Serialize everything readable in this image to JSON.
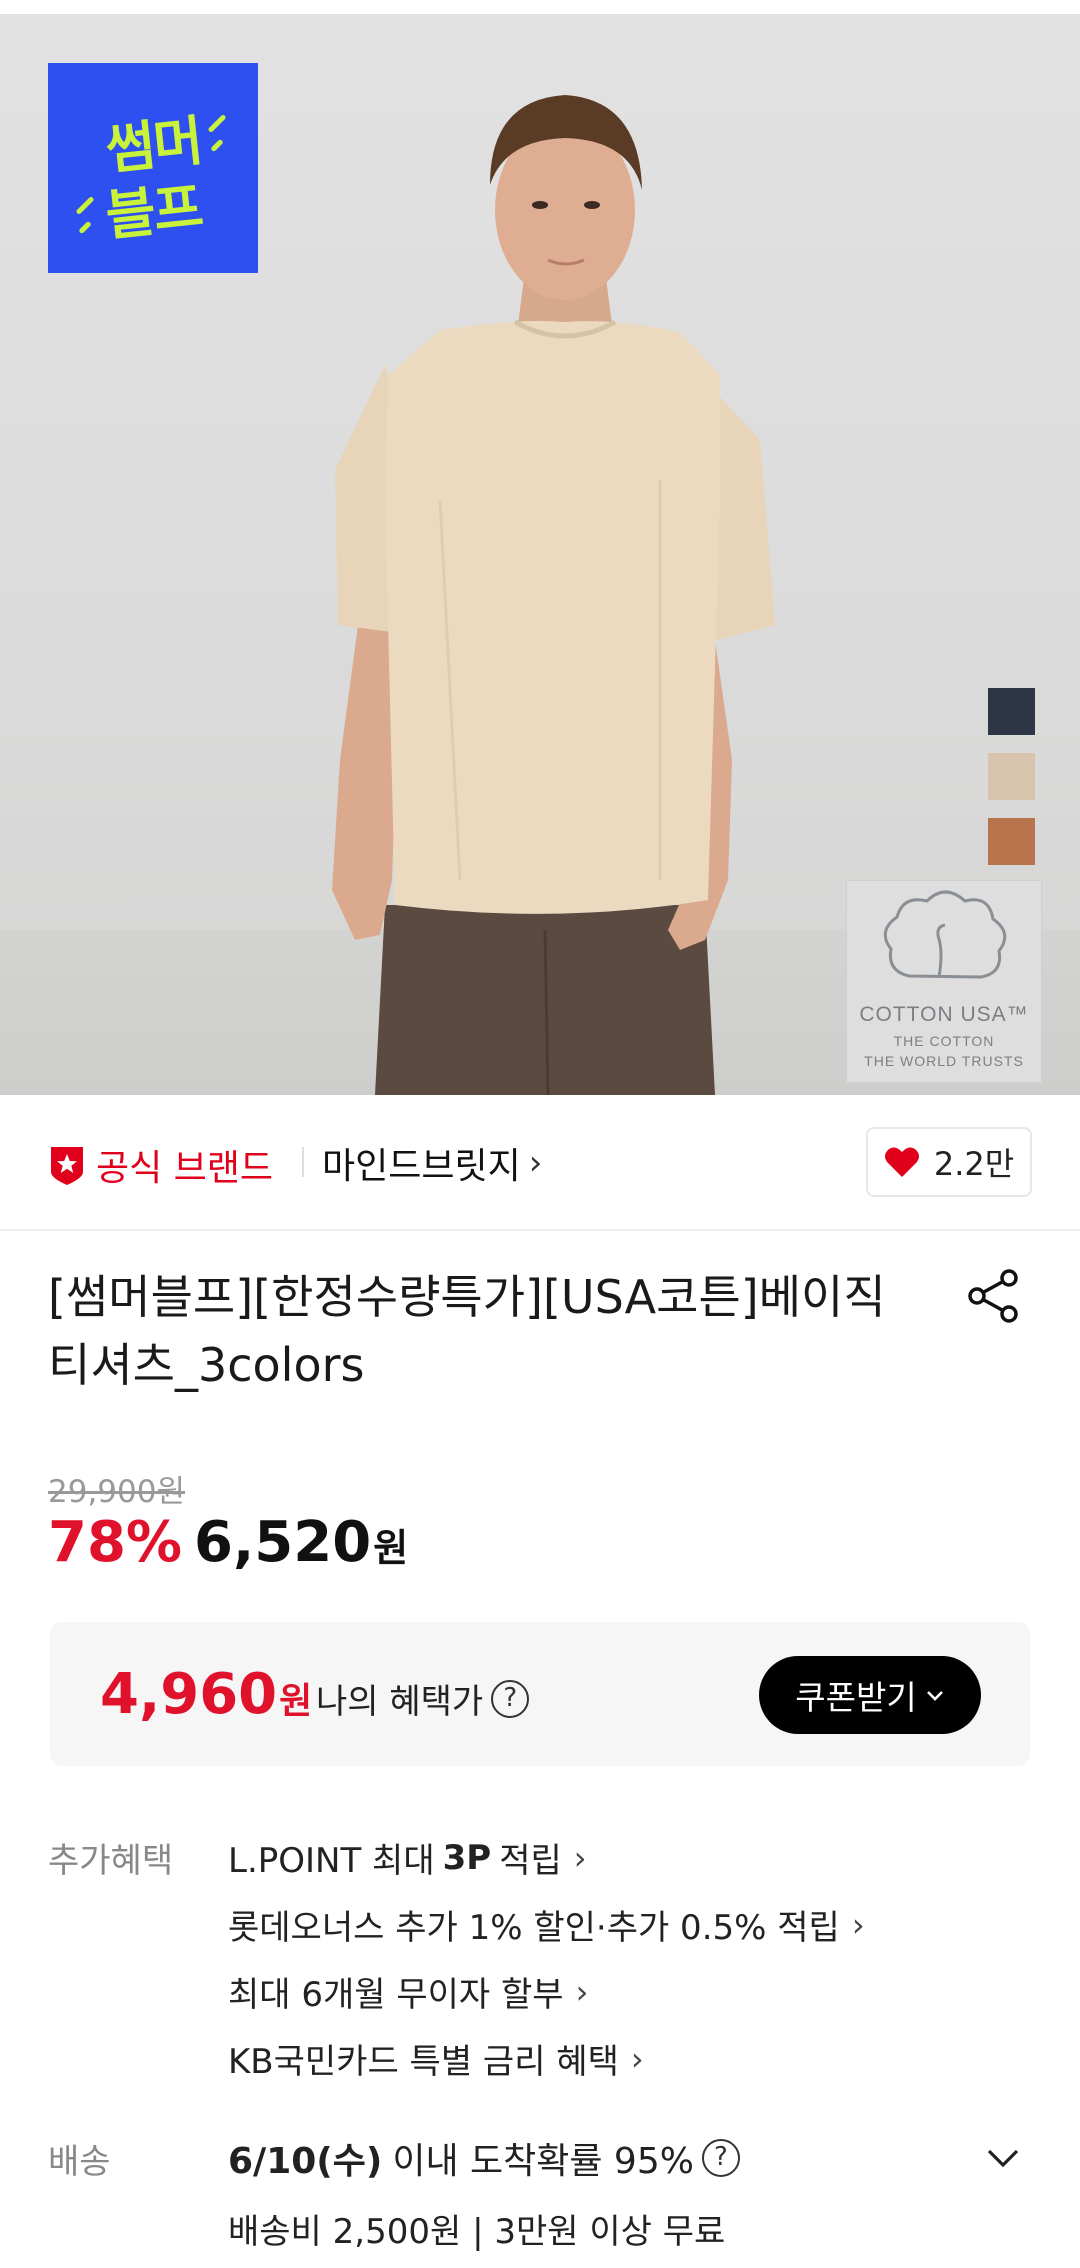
{
  "badge": {
    "line1": "썸머",
    "line2": "블프"
  },
  "swatches": {
    "colors": [
      "#2e3545",
      "#d8c4ad",
      "#b8744c"
    ]
  },
  "cotton_logo": {
    "title": "COTTON USA™",
    "sub1": "THE COTTON",
    "sub2": "THE WORLD TRUSTS"
  },
  "brand": {
    "official_label": "공식 브랜드",
    "name": "마인드브릿지",
    "chevron": "›",
    "likes": "2.2만"
  },
  "product": {
    "title": "[썸머블프][한정수량특가][USA코튼]베이직 티셔츠_3colors"
  },
  "price": {
    "original": "29,900원",
    "discount": "78%",
    "sale": "6,520",
    "won": "원"
  },
  "benefit": {
    "price": "4,960",
    "won": "원",
    "label": "나의 혜택가",
    "help": "?",
    "coupon_button": "쿠폰받기"
  },
  "extra": {
    "label": "추가혜택",
    "items": [
      {
        "pre": "L.POINT 최대",
        "bold": "3P",
        "post": "적립",
        "chev": "›"
      },
      {
        "text": "롯데오너스 추가 1% 할인·추가 0.5% 적립",
        "chev": "›"
      },
      {
        "text": "최대 6개월 무이자 할부",
        "chev": "›"
      },
      {
        "text": "KB국민카드 특별 금리 혜택",
        "chev": "›"
      }
    ]
  },
  "shipping": {
    "label": "배송",
    "date": "6/10(수)",
    "arrival": "이내 도착확률 95%",
    "help": "?",
    "fee": "배송비 2,500원 | 3만원 이상 무료"
  },
  "colors": {
    "accent": "#e0112b",
    "badge_bg": "#2f50f0",
    "badge_text": "#c9f23a"
  }
}
